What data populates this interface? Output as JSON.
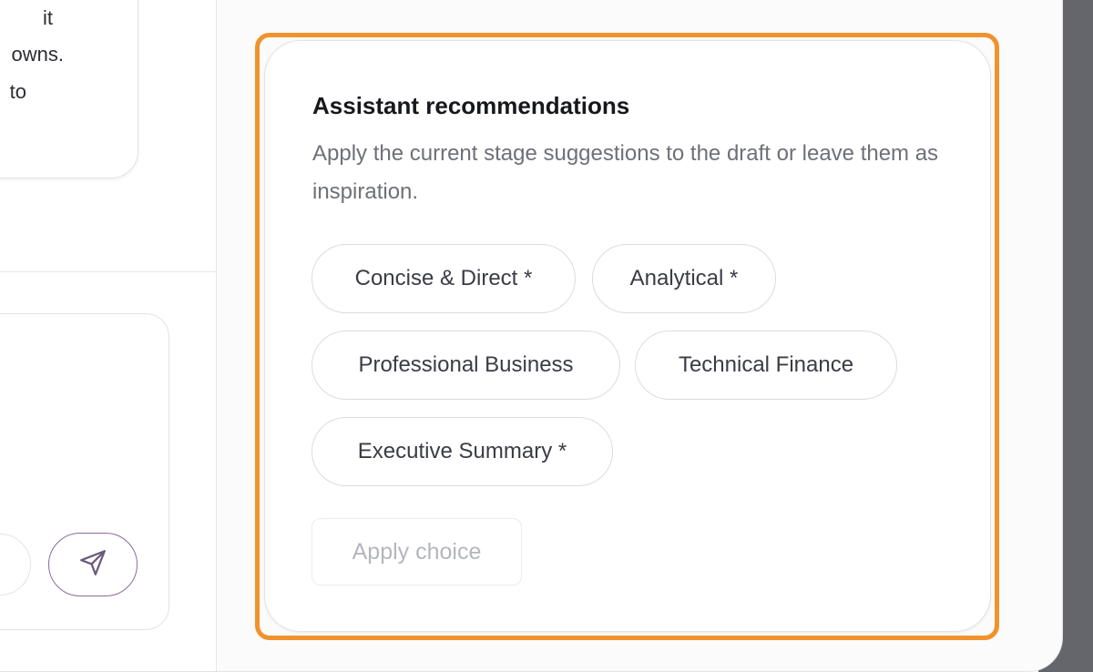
{
  "chat": {
    "message_lines": [
      "it",
      "owns.",
      "to"
    ]
  },
  "recommendations": {
    "title": "Assistant recommendations",
    "description": "Apply the current stage suggestions to the draft or leave them as inspiration.",
    "chips": [
      {
        "label": "Concise & Direct *"
      },
      {
        "label": "Analytical *"
      },
      {
        "label": "Professional Business"
      },
      {
        "label": "Technical Finance"
      },
      {
        "label": "Executive Summary *"
      }
    ],
    "apply_label": "Apply choice",
    "apply_enabled": false
  },
  "colors": {
    "focus_ring": "#f0922d",
    "send_button_accent": "#8a6aa0",
    "backdrop": "#64666b"
  },
  "icons": {
    "send_button": "send-icon"
  }
}
